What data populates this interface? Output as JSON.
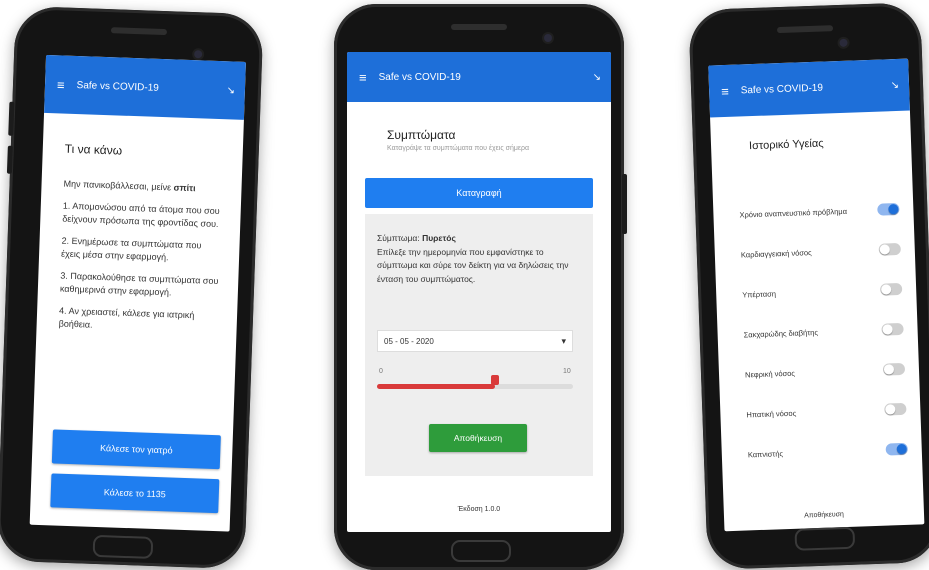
{
  "app": {
    "title": "Safe vs COVID-19",
    "menu_icon": "menu-icon",
    "share_icon": "share-icon",
    "brand_color": "#1e6fd9"
  },
  "screen1": {
    "title": "Τι να κάνω",
    "intro_prefix": "Μην πανικοβάλλεσαι, μείνε ",
    "intro_bold": "σπίτι",
    "steps": [
      "1. Απομονώσου από τα άτομα που σου δείχνουν πρόσωπα της φροντίδας σου.",
      "2. Ενημέρωσε τα συμπτώματα που έχεις μέσα στην εφαρμογή.",
      "3. Παρακολούθησε τα συμπτώματα σου καθημερινά στην εφαρμογή.",
      "4. Αν χρειαστεί, κάλεσε για ιατρική βοήθεια."
    ],
    "button_primary": "Κάλεσε τον γιατρό",
    "button_secondary": "Κάλεσε το 1135"
  },
  "screen2": {
    "title": "Συμπτώματα",
    "subtitle": "Καταγράψε τα συμπτώματα που έχεις σήμερα",
    "main_button": "Καταγραφή",
    "panel_prefix": "Σύμπτωμα: ",
    "panel_bold": "Πυρετός",
    "panel_text": "Επίλεξε την ημερομηνία που εμφανίστηκε το σύμπτωμα και σύρε τον δείκτη για να δηλώσεις την ένταση του συμπτώματος.",
    "date_value": "05 - 05 - 2020",
    "calendar_icon": "calendar-icon",
    "slider_min": "0",
    "slider_max": "10",
    "slider_value": 6,
    "slider_color": "#d93a3a",
    "save_button": "Αποθήκευση",
    "save_color": "#2e9c3b",
    "footer": "Έκδοση 1.0.0"
  },
  "screen3": {
    "title": "Ιστορικό Υγείας",
    "items": [
      {
        "label": "Χρόνιο αναπνευστικό πρόβλημα",
        "on": true
      },
      {
        "label": "Καρδιαγγειακή νόσος",
        "on": false
      },
      {
        "label": "Υπέρταση",
        "on": false
      },
      {
        "label": "Σακχαρώδης διαβήτης",
        "on": false
      },
      {
        "label": "Νεφρική νόσος",
        "on": false
      },
      {
        "label": "Ηπατική νόσος",
        "on": false
      },
      {
        "label": "Καπνιστής",
        "on": true
      }
    ],
    "footer": "Αποθήκευση"
  }
}
